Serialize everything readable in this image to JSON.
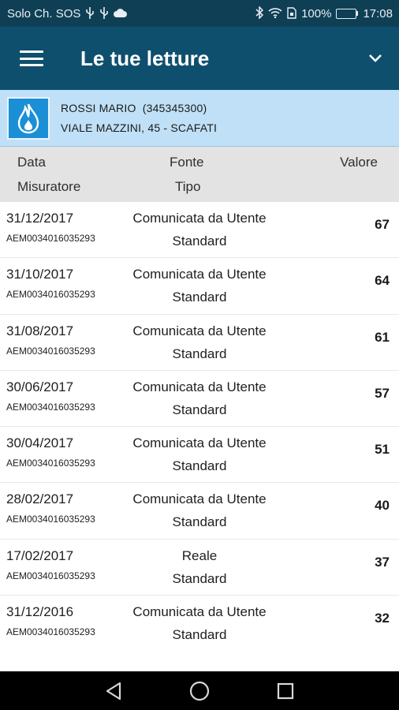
{
  "status_bar": {
    "carrier": "Solo Ch. SOS",
    "icons_left": [
      "usb-icon",
      "usb-icon",
      "cloud-icon"
    ],
    "battery_percent": "100%",
    "time": "17:08"
  },
  "app_bar": {
    "title": "Le tue letture"
  },
  "customer": {
    "name_line": "ROSSI MARIO  (345345300)",
    "address_line": "VIALE MAZZINI, 45 - SCAFATI"
  },
  "table_header": {
    "col1_top": "Data",
    "col1_bottom": "Misuratore",
    "col2_top": "Fonte",
    "col2_bottom": "Tipo",
    "col3": "Valore"
  },
  "readings": [
    {
      "date": "31/12/2017",
      "meter": "AEM0034016035293",
      "source": "Comunicata da Utente",
      "type": "Standard",
      "value": "67"
    },
    {
      "date": "31/10/2017",
      "meter": "AEM0034016035293",
      "source": "Comunicata da Utente",
      "type": "Standard",
      "value": "64"
    },
    {
      "date": "31/08/2017",
      "meter": "AEM0034016035293",
      "source": "Comunicata da Utente",
      "type": "Standard",
      "value": "61"
    },
    {
      "date": "30/06/2017",
      "meter": "AEM0034016035293",
      "source": "Comunicata da Utente",
      "type": "Standard",
      "value": "57"
    },
    {
      "date": "30/04/2017",
      "meter": "AEM0034016035293",
      "source": "Comunicata da Utente",
      "type": "Standard",
      "value": "51"
    },
    {
      "date": "28/02/2017",
      "meter": "AEM0034016035293",
      "source": "Comunicata da Utente",
      "type": "Standard",
      "value": "40"
    },
    {
      "date": "17/02/2017",
      "meter": "AEM0034016035293",
      "source": "Reale",
      "type": "Standard",
      "value": "37"
    },
    {
      "date": "31/12/2016",
      "meter": "AEM0034016035293",
      "source": "Comunicata da Utente",
      "type": "Standard",
      "value": "32"
    }
  ],
  "colors": {
    "status_bar": "#0f3f55",
    "app_bar": "#0f4f6e",
    "customer_card": "#bfe0f6",
    "header_bg": "#e3e3e3",
    "logo_bg": "#1a8fd6",
    "battery": "#45c442"
  }
}
